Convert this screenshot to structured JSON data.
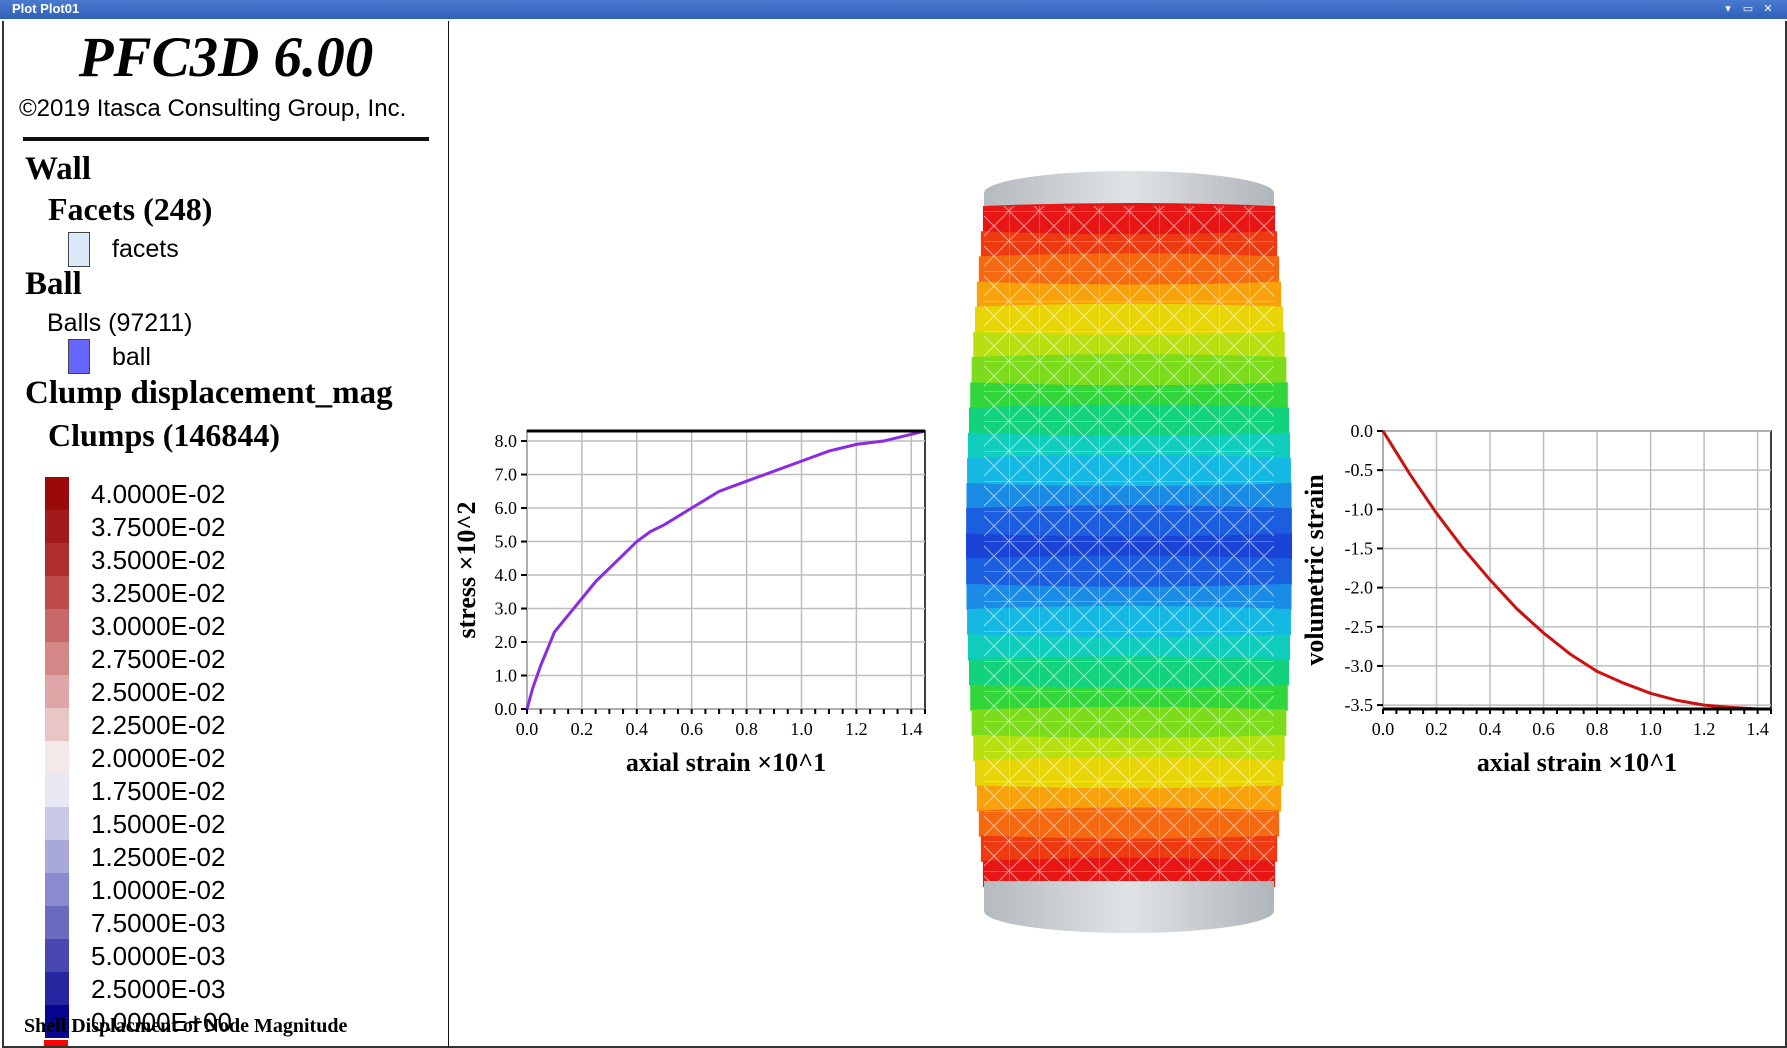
{
  "window": {
    "title": "Plot Plot01",
    "controls": [
      "chevron-down-icon",
      "restore-icon",
      "close-icon"
    ]
  },
  "legend": {
    "app_title": "PFC3D 6.00",
    "copyright": "©2019 Itasca Consulting Group, Inc.",
    "wall": {
      "heading": "Wall",
      "facets_heading": "Facets (248)",
      "facets_label": "facets",
      "facets_color": "#dce9f8"
    },
    "ball": {
      "heading": "Ball",
      "balls_heading": "Balls (97211)",
      "ball_label": "ball",
      "ball_color": "#6666ff"
    },
    "clump": {
      "heading": "Clump displacement_mag",
      "clumps_heading": "Clumps (146844)",
      "colorbar": [
        {
          "label": "4.0000E-02",
          "color": "#9b0a0a"
        },
        {
          "label": "3.7500E-02",
          "color": "#a31a1a"
        },
        {
          "label": "3.5000E-02",
          "color": "#b02e2e"
        },
        {
          "label": "3.2500E-02",
          "color": "#bd4b4b"
        },
        {
          "label": "3.0000E-02",
          "color": "#c86868"
        },
        {
          "label": "2.7500E-02",
          "color": "#d38787"
        },
        {
          "label": "2.5000E-02",
          "color": "#dea6a6"
        },
        {
          "label": "2.2500E-02",
          "color": "#e9c6c6"
        },
        {
          "label": "2.0000E-02",
          "color": "#f4e8e8"
        },
        {
          "label": "1.7500E-02",
          "color": "#e8e8f4"
        },
        {
          "label": "1.5000E-02",
          "color": "#c9c9e8"
        },
        {
          "label": "1.2500E-02",
          "color": "#a8a8db"
        },
        {
          "label": "1.0000E-02",
          "color": "#8a8ace"
        },
        {
          "label": "7.5000E-03",
          "color": "#6b6bc0"
        },
        {
          "label": "5.0000E-03",
          "color": "#4848b0"
        },
        {
          "label": "2.5000E-03",
          "color": "#2626a0"
        },
        {
          "label": "0.0000E+00",
          "color": "#050590"
        }
      ]
    },
    "shell_label": "Shell Displacment of Node Magnitude"
  },
  "stress_chart": {
    "chart_data": {
      "type": "line",
      "xlabel": "axial strain ×10^1",
      "ylabel": "stress ×10^2",
      "xlim": [
        0,
        1.45
      ],
      "ylim": [
        0,
        8.3
      ],
      "xticks": [
        "0.0",
        "0.2",
        "0.4",
        "0.6",
        "0.8",
        "1.0",
        "1.2",
        "1.4"
      ],
      "yticks": [
        "0.0",
        "1.0",
        "2.0",
        "3.0",
        "4.0",
        "5.0",
        "6.0",
        "7.0",
        "8.0"
      ],
      "grid": true,
      "series": [
        {
          "color": "#8a2be2",
          "x": [
            0.0,
            0.02,
            0.05,
            0.08,
            0.1,
            0.15,
            0.2,
            0.25,
            0.3,
            0.35,
            0.4,
            0.45,
            0.5,
            0.6,
            0.7,
            0.8,
            0.9,
            1.0,
            1.1,
            1.2,
            1.3,
            1.4,
            1.45
          ],
          "y": [
            0.0,
            0.6,
            1.3,
            1.9,
            2.3,
            2.8,
            3.3,
            3.8,
            4.2,
            4.6,
            5.0,
            5.3,
            5.5,
            6.0,
            6.5,
            6.8,
            7.1,
            7.4,
            7.7,
            7.9,
            8.0,
            8.2,
            8.3
          ]
        }
      ]
    }
  },
  "volumetric_chart": {
    "chart_data": {
      "type": "line",
      "xlabel": "axial strain ×10^1",
      "ylabel": "volumetric strain",
      "xlim": [
        0,
        1.45
      ],
      "ylim": [
        -3.55,
        0
      ],
      "xticks": [
        "0.0",
        "0.2",
        "0.4",
        "0.6",
        "0.8",
        "1.0",
        "1.2",
        "1.4"
      ],
      "yticks": [
        "0.0",
        "-0.5",
        "-1.0",
        "-1.5",
        "-2.0",
        "-2.5",
        "-3.0",
        "-3.5"
      ],
      "grid": true,
      "series": [
        {
          "color": "#cc1111",
          "x": [
            0.0,
            0.1,
            0.2,
            0.3,
            0.4,
            0.5,
            0.6,
            0.7,
            0.8,
            0.9,
            1.0,
            1.1,
            1.2,
            1.3,
            1.4,
            1.45
          ],
          "y": [
            0.0,
            -0.55,
            -1.05,
            -1.5,
            -1.9,
            -2.27,
            -2.58,
            -2.85,
            -3.07,
            -3.22,
            -3.35,
            -3.44,
            -3.5,
            -3.53,
            -3.55,
            -3.55
          ]
        }
      ]
    }
  },
  "specimen": {
    "band_colors": [
      "#e81515",
      "#ee3a10",
      "#f56a10",
      "#f7a20a",
      "#e8d508",
      "#b8e010",
      "#7cdc1c",
      "#32d63a",
      "#12d27e",
      "#10cdbd",
      "#14b8e2",
      "#1a8ce6",
      "#1c5ee0",
      "#1a44d6"
    ],
    "cap_color": "#cfd3d8"
  }
}
